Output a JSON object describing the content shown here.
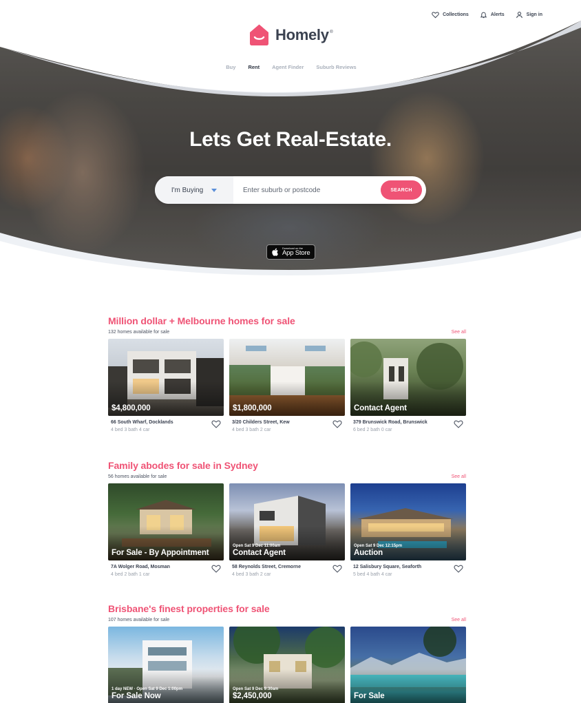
{
  "header": {
    "util_links": [
      {
        "label": "Collections",
        "icon": "heart-icon"
      },
      {
        "label": "Alerts",
        "icon": "bell-icon"
      },
      {
        "label": "Sign in",
        "icon": "user-icon"
      }
    ],
    "logo_text": "Homely",
    "logo_reg": "®",
    "brand_color": "#ef5375",
    "nav": [
      "Buy",
      "Rent",
      "Agent Finder",
      "Suburb Reviews"
    ],
    "nav_active": "Rent"
  },
  "hero": {
    "title": "Lets Get Real-Estate.",
    "search": {
      "type_label": "I'm Buying",
      "placeholder": "Enter suburb or postcode",
      "button_label": "SEARCH"
    },
    "app_store": {
      "small": "Download on the",
      "big": "App Store"
    }
  },
  "sections": [
    {
      "title": "Million dollar + Melbourne homes for sale",
      "subtitle": "132 homes available for sale",
      "see_all": "See all",
      "cards": [
        {
          "price": "$4,800,000",
          "inspect": "",
          "address": "66 South Wharf, Docklands",
          "features": "4 bed  3 bath  4 car"
        },
        {
          "price": "$1,800,000",
          "inspect": "",
          "address": "3/20 Childers Street, Kew",
          "features": "4 bed  3 bath  2 car"
        },
        {
          "price": "Contact Agent",
          "inspect": "",
          "address": "379 Brunswick Road, Brunswick",
          "features": "6 bed  2 bath  0 car"
        }
      ]
    },
    {
      "title": "Family abodes for sale in Sydney",
      "subtitle": "56 homes available for sale",
      "see_all": "See all",
      "cards": [
        {
          "price": "For Sale - By Appointment",
          "inspect": "",
          "address": "7A Wolger Road, Mosman",
          "features": "4 bed  2 bath  1 car"
        },
        {
          "price": "Contact Agent",
          "inspect": "Open Sat 9 Dec 11:00am",
          "address": "58 Reynolds Street, Cremorne",
          "features": "4 bed  3 bath  2 car"
        },
        {
          "price": "Auction",
          "inspect": "Open Sat 9 Dec 12:15pm",
          "address": "12 Salisbury Square, Seaforth",
          "features": "5 bed  4 bath  4 car"
        }
      ]
    },
    {
      "title": "Brisbane's finest properties for sale",
      "subtitle": "107 homes available for sale",
      "see_all": "See all",
      "cards": [
        {
          "price": "For Sale Now",
          "inspect": "1 day NEW · Open Sat 9 Dec 1:00pm",
          "address": "",
          "features": ""
        },
        {
          "price": "$2,450,000",
          "inspect": "Open Sat 9 Dec 9:30am",
          "address": "",
          "features": ""
        },
        {
          "price": "For Sale",
          "inspect": "",
          "address": "",
          "features": ""
        }
      ]
    }
  ]
}
